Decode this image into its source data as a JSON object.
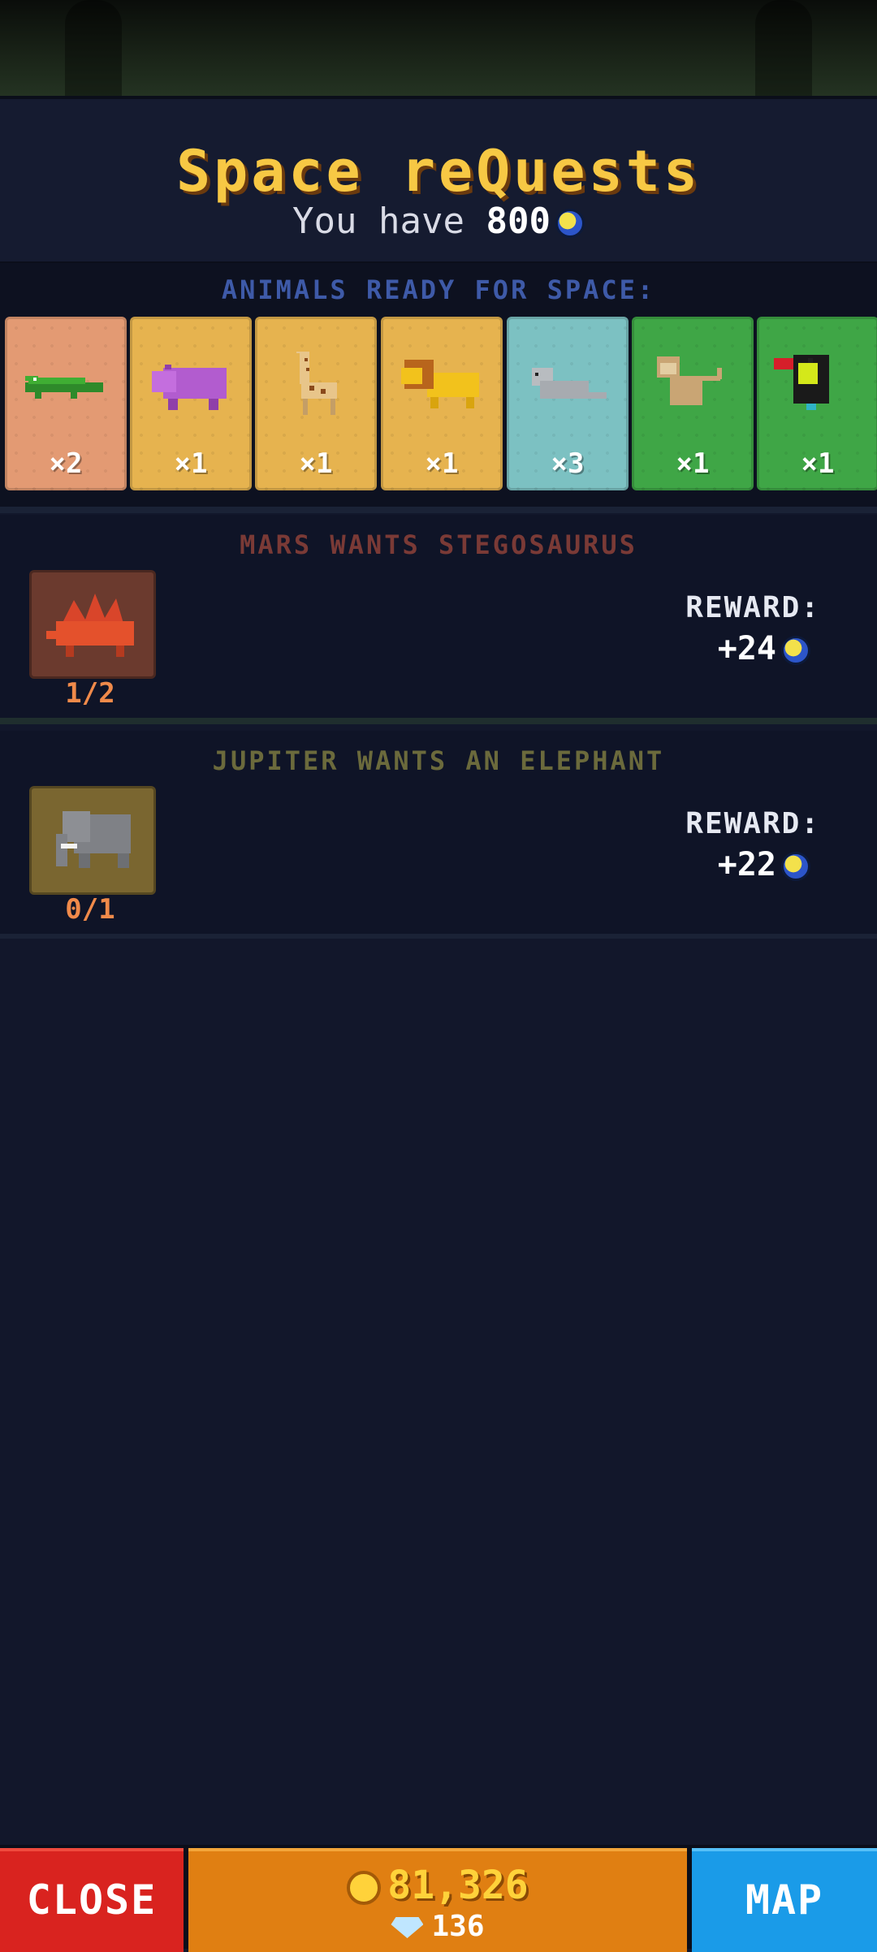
{
  "header": {
    "title": "Space reQuests",
    "subtitle_prefix": "You have",
    "balance": "800"
  },
  "animals": {
    "label": "ANIMALS READY FOR SPACE:",
    "items": [
      {
        "name": "crocodile",
        "count": "×2",
        "color": "#e39a73"
      },
      {
        "name": "hippo",
        "count": "×1",
        "color": "#e6b34f"
      },
      {
        "name": "giraffe",
        "count": "×1",
        "color": "#e6b34f"
      },
      {
        "name": "lion",
        "count": "×1",
        "color": "#e6b34f"
      },
      {
        "name": "seal",
        "count": "×3",
        "color": "#7cc1c2"
      },
      {
        "name": "monkey",
        "count": "×1",
        "color": "#3fa646"
      },
      {
        "name": "toucan",
        "count": "×1",
        "color": "#3fa646"
      }
    ]
  },
  "quests": [
    {
      "title": "MARS WANTS STEGOSAURUS",
      "animal": "stegosaurus",
      "progress": "1/2",
      "reward_label": "REWARD:",
      "reward": "+24",
      "title_color": "#7a3a36",
      "slot_color": "#6b3a2e"
    },
    {
      "title": "JUPITER WANTS AN ELEPHANT",
      "animal": "elephant",
      "progress": "0/1",
      "reward_label": "REWARD:",
      "reward": "+22",
      "title_color": "#6b6a3c",
      "slot_color": "#7a6630"
    }
  ],
  "bottom": {
    "close_label": "CLOSE",
    "gold": "81,326",
    "gems": "136",
    "map_label": "MAP"
  }
}
